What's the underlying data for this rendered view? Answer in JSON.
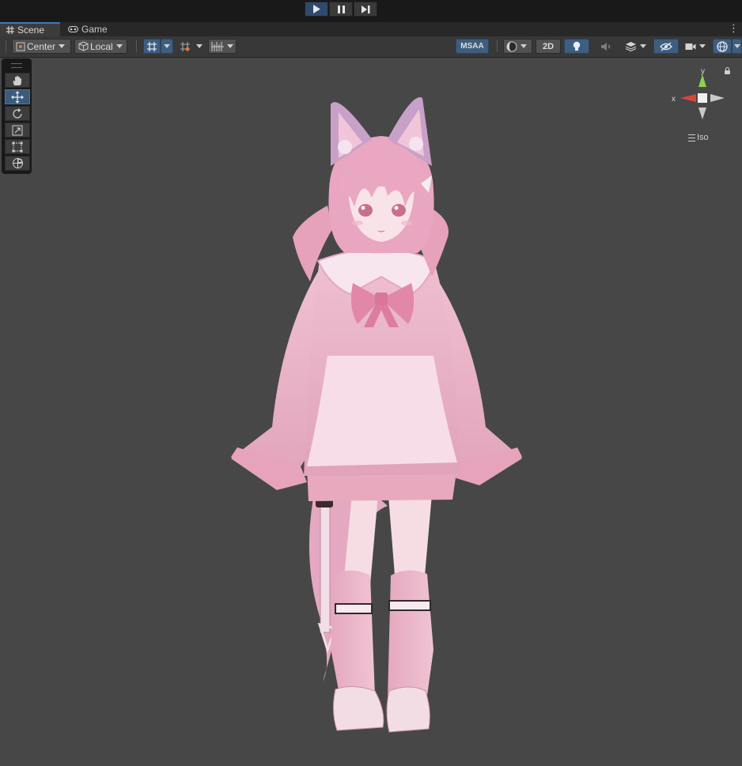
{
  "tabs": [
    {
      "label": "Scene",
      "icon": "grid-icon",
      "active": true
    },
    {
      "label": "Game",
      "icon": "gamepad-icon",
      "active": false
    }
  ],
  "playbar": {
    "play_icon": "play-icon",
    "pause_icon": "pause-icon",
    "step_icon": "step-icon",
    "play_active": true
  },
  "toolbar": {
    "pivot_mode": "Center",
    "pivot_space": "Local",
    "msaa_label": "MSAA",
    "mode_2d_label": "2D",
    "accent_color": "#3e5e80"
  },
  "tools": [
    {
      "name": "hand-tool",
      "icon": "hand-icon",
      "active": false
    },
    {
      "name": "move-tool",
      "icon": "move-icon",
      "active": true
    },
    {
      "name": "rotate-tool",
      "icon": "rotate-icon",
      "active": false
    },
    {
      "name": "scale-tool",
      "icon": "scale-icon",
      "active": false
    },
    {
      "name": "rect-tool",
      "icon": "rect-icon",
      "active": false
    },
    {
      "name": "transform-tool",
      "icon": "transform-icon",
      "active": false
    }
  ],
  "gizmo": {
    "y_label": "y",
    "x_label": "x",
    "projection_label": "Iso",
    "x_color": "#d9453b",
    "y_color": "#8bd14a"
  },
  "viewport": {
    "background": "#474747",
    "subject": "pink fox-eared anime avatar character model"
  }
}
